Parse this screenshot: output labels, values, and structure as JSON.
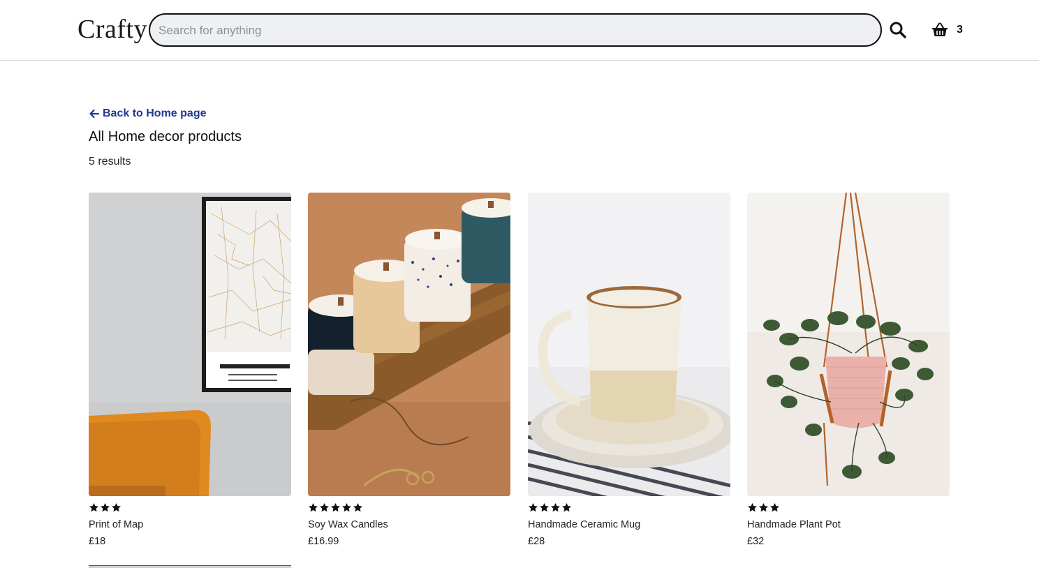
{
  "header": {
    "logo": "Crafty",
    "search_placeholder": "Search for anything",
    "search_icon": "search-icon",
    "basket_icon": "basket-icon",
    "basket_count": "3"
  },
  "main": {
    "back_link": "Back to Home page",
    "back_icon": "arrow-left-icon",
    "title": "All Home decor products",
    "result_count": "5 results"
  },
  "products": [
    {
      "name": "Print of Map",
      "price": "£18",
      "rating": 3,
      "image": "copenhagen-map-print-photo"
    },
    {
      "name": "Soy Wax Candles",
      "price": "£16.99",
      "rating": 5,
      "image": "soy-wax-candles-photo"
    },
    {
      "name": "Handmade Ceramic Mug",
      "price": "£28",
      "rating": 4,
      "image": "ceramic-mug-photo"
    },
    {
      "name": "Handmade Plant Pot",
      "price": "£32",
      "rating": 3,
      "image": "hanging-plant-pot-photo"
    }
  ],
  "colors": {
    "link": "#1e3a8a",
    "search_bg": "#eef0f3",
    "text": "#111111"
  }
}
